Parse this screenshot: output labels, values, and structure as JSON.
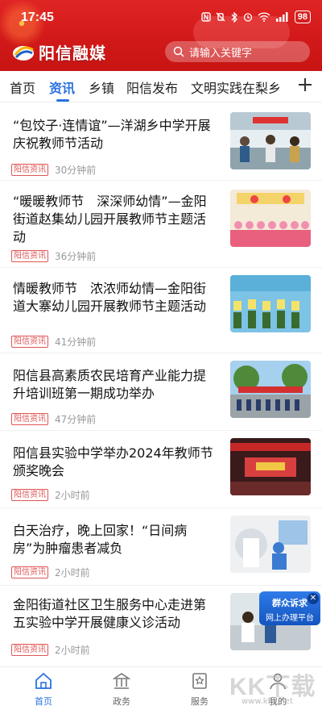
{
  "status": {
    "time": "17:45",
    "battery": "98"
  },
  "header": {
    "logo_text": "阳信融媒",
    "search_placeholder": "请输入关键字"
  },
  "tabs": [
    {
      "label": "首页"
    },
    {
      "label": "资讯"
    },
    {
      "label": "乡镇"
    },
    {
      "label": "阳信发布"
    },
    {
      "label": "文明实践在梨乡"
    }
  ],
  "news": [
    {
      "title": "“包饺子·连情谊”—洋湖乡中学开展庆祝教师节活动",
      "tag": "阳信资讯",
      "ago": "30分钟前"
    },
    {
      "title": "“暖暖教师节　深深师幼情”—金阳街道赵集幼儿园开展教师节主题活动",
      "tag": "阳信资讯",
      "ago": "36分钟前"
    },
    {
      "title": "情暖教师节　浓浓师幼情—金阳街道大寨幼儿园开展教师节主题活动",
      "tag": "阳信资讯",
      "ago": "41分钟前"
    },
    {
      "title": "阳信县高素质农民培育产业能力提升培训班第一期成功举办",
      "tag": "阳信资讯",
      "ago": "47分钟前"
    },
    {
      "title": "阳信县实验中学举办2024年教师节颁奖晚会",
      "tag": "阳信资讯",
      "ago": "2小时前"
    },
    {
      "title": "白天治疗，晚上回家！“日间病房”为肿瘤患者减负",
      "tag": "阳信资讯",
      "ago": "2小时前"
    },
    {
      "title": "金阳街道社区卫生服务中心走进第五实验中学开展健康义诊活动",
      "tag": "阳信资讯",
      "ago": "2小时前"
    }
  ],
  "promo": {
    "line1": "群众诉求",
    "line2": "网上办理平台"
  },
  "bottom_nav": [
    {
      "label": "首页"
    },
    {
      "label": "政务"
    },
    {
      "label": "服务"
    },
    {
      "label": "我的"
    }
  ],
  "watermark": {
    "text": "KK下载",
    "url": "www.kkx.net"
  },
  "colors": {
    "brand_red": "#d11818",
    "accent_blue": "#2a72e0"
  }
}
